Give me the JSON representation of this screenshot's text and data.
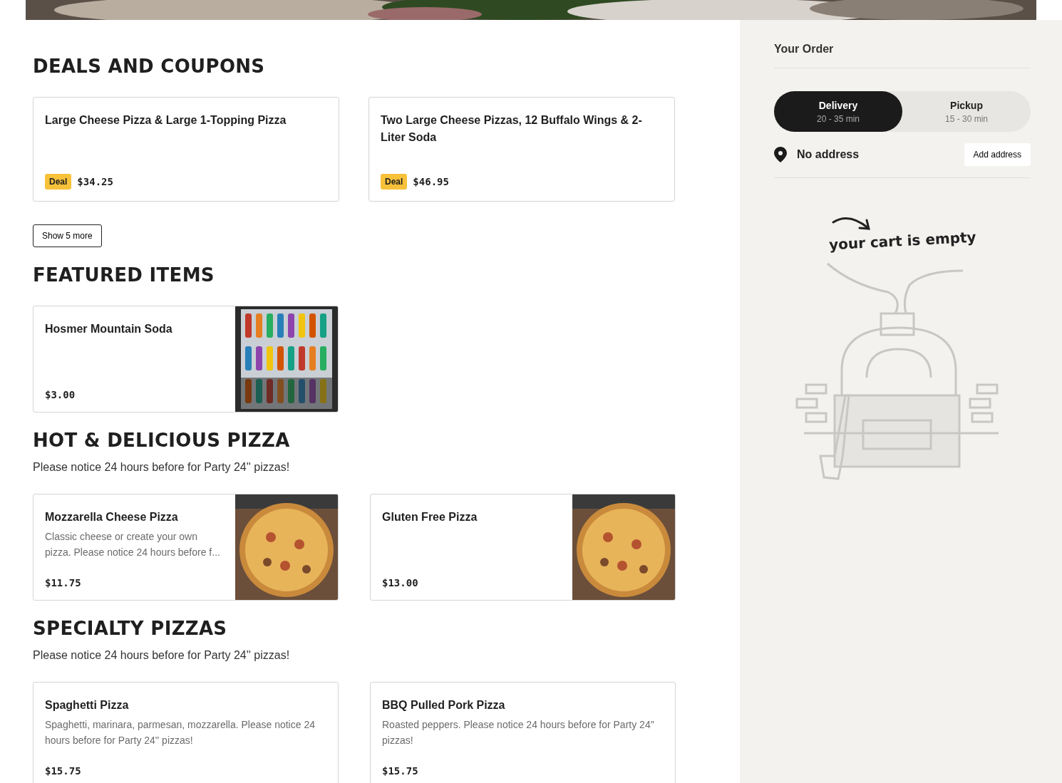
{
  "sections": [
    {
      "kind": "deals",
      "title": "DEALS AND COUPONS",
      "cards": [
        {
          "name": "Large Cheese Pizza & Large 1-Topping Pizza",
          "badge": "Deal",
          "price": "$34.25"
        },
        {
          "name": "Two Large Cheese Pizzas, 12 Buffalo Wings & 2-Liter Soda",
          "badge": "Deal",
          "price": "$46.95"
        }
      ],
      "more_button": "Show 5 more"
    },
    {
      "kind": "featured",
      "title": "FEATURED ITEMS",
      "cards": [
        {
          "name": "Hosmer Mountain Soda",
          "price": "$3.00"
        }
      ]
    },
    {
      "kind": "menu",
      "title": "HOT & DELICIOUS PIZZA",
      "note": "Please notice 24 hours before for Party 24'' pizzas!",
      "cards": [
        {
          "name": "Mozzarella Cheese Pizza",
          "description": "Classic cheese or create your own pizza. Please notice 24 hours before f...",
          "price": "$11.75"
        },
        {
          "name": "Gluten Free Pizza",
          "price": "$13.00"
        }
      ]
    },
    {
      "kind": "menu",
      "title": "SPECIALTY PIZZAS",
      "note": "Please notice 24 hours before for Party 24'' pizzas!",
      "cards": [
        {
          "kind": "plain",
          "name": "Spaghetti Pizza",
          "description": "Spaghetti, marinara, parmesan, mozzarella. Please notice 24 hours before for Party 24'' pizzas!",
          "price": "$15.75"
        },
        {
          "kind": "plain",
          "name": "BBQ Pulled Pork Pizza",
          "description": "Roasted peppers. Please notice 24 hours before for Party 24'' pizzas!",
          "price": "$15.75"
        }
      ]
    }
  ],
  "order": {
    "title": "Your Order",
    "modes": [
      {
        "label": "Delivery",
        "time": "20 - 35 min",
        "selected": true
      },
      {
        "label": "Pickup",
        "time": "15 - 30 min",
        "selected": false
      }
    ],
    "address": {
      "text": "No address",
      "button": "Add address"
    },
    "empty_message": "your cart is empty"
  }
}
